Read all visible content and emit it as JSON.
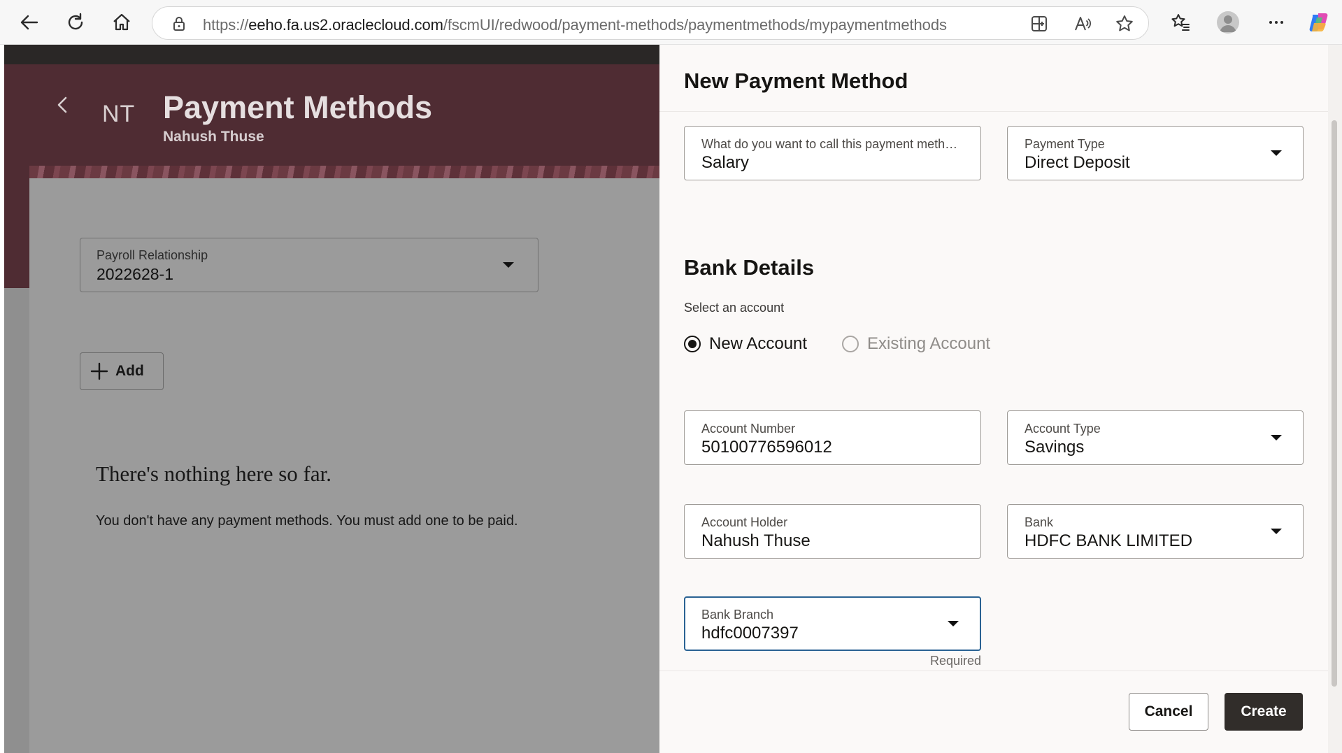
{
  "browser": {
    "url_prefix": "https://",
    "url_host": "eeho.fa.us2.oraclecloud.com",
    "url_path": "/fscmUI/redwood/payment-methods/paymentmethods/mypaymentmethods"
  },
  "page": {
    "initials": "NT",
    "title": "Payment Methods",
    "subtitle": "Nahush Thuse",
    "payroll": {
      "label": "Payroll Relationship",
      "value": "2022628-1"
    },
    "add_label": "Add",
    "empty_title": "There's nothing here so far.",
    "empty_text": "You don't have any payment methods. You must add one to be paid."
  },
  "drawer": {
    "title": "New Payment Method",
    "name_field": {
      "label": "What do you want to call this payment method?",
      "value": "Salary"
    },
    "payment_type": {
      "label": "Payment Type",
      "value": "Direct Deposit"
    },
    "bank_details_title": "Bank Details",
    "select_account_label": "Select an account",
    "radio_new": "New Account",
    "radio_existing": "Existing Account",
    "account_number": {
      "label": "Account Number",
      "value": "50100776596012"
    },
    "account_type": {
      "label": "Account Type",
      "value": "Savings"
    },
    "account_holder": {
      "label": "Account Holder",
      "value": "Nahush Thuse"
    },
    "bank": {
      "label": "Bank",
      "value": "HDFC BANK LIMITED"
    },
    "bank_branch": {
      "label": "Bank Branch",
      "value": "hdfc0007397"
    },
    "required_hint": "Required",
    "cancel_label": "Cancel",
    "create_label": "Create"
  },
  "colors": {
    "header": "#4f2c33",
    "primary_button": "#312d2a",
    "focus_border": "#2a6293",
    "overlay_gray": "#9b9b9b"
  },
  "icons": {
    "back": "back-arrow-icon",
    "refresh": "refresh-icon",
    "home": "home-icon",
    "site_info": "lock-icon",
    "split": "split-screen-icon",
    "read_aloud": "read-aloud-icon",
    "favorite": "star-icon",
    "favorites": "favorites-list-icon",
    "profile": "profile-avatar-icon",
    "more": "more-dots-icon",
    "copilot": "copilot-icon",
    "caret": "caret-down-icon",
    "plus": "plus-icon",
    "chevron": "chevron-left-icon"
  }
}
